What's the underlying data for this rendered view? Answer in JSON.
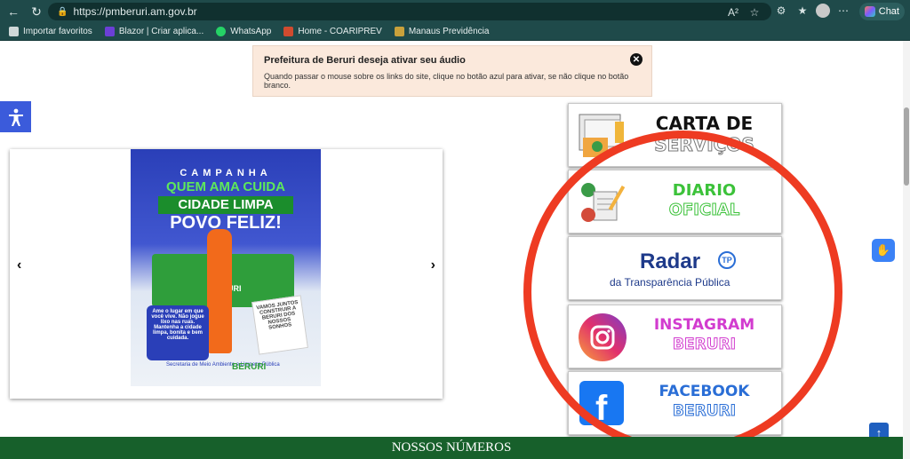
{
  "browser": {
    "url": "https://pmberuri.am.gov.br",
    "chat_label": "Chat",
    "bookmarks": [
      {
        "label": "Importar favoritos",
        "icon": "folder-icon"
      },
      {
        "label": "Blazor | Criar aplica...",
        "icon": "dotnet-icon"
      },
      {
        "label": "WhatsApp",
        "icon": "whatsapp-icon"
      },
      {
        "label": "Home - COARIPREV",
        "icon": "flag-icon"
      },
      {
        "label": "Manaus Previdência",
        "icon": "crest-icon"
      }
    ]
  },
  "audio_banner": {
    "title": "Prefeitura de Beruri deseja ativar seu áudio",
    "text": "Quando passar o mouse sobre os links do site, clique no botão azul para ativar, se não clique no botão branco."
  },
  "campaign": {
    "line1": "CAMPANHA",
    "line2": "QUEM AMA CUIDA",
    "line3": "CIDADE LIMPA",
    "line4": "POVO FELIZ!",
    "truck_label": "BERURI",
    "left_bubble": "Ame o lugar em que você vive. Não jogue lixo nas ruas. Mantenha a cidade limpa, bonita e bem cuidada.",
    "right_bubble": "VAMOS JUNTOS CONSTRUIR A BERURI DOS NOSSOS SONHOS",
    "footer": "Secretaria de Meio Ambiente e Limpeza Pública",
    "brand": "BERURI"
  },
  "cards": {
    "carta": {
      "line1": "CARTA DE",
      "line2": "SERVIÇOS"
    },
    "diario": {
      "line1": "DIARIO",
      "line2": "OFICIAL"
    },
    "radar": {
      "title": "Radar",
      "subtitle": "da Transparência Pública",
      "badge": "TP"
    },
    "instagram": {
      "line1": "INSTAGRAM",
      "line2": "BERURI"
    },
    "facebook": {
      "line1": "FACEBOOK",
      "line2": "BERURI"
    }
  },
  "section_title": "NOSSOS NÚMEROS",
  "colors": {
    "browser_bg": "#1f4a4a",
    "banner_bg": "#fbe9dc",
    "accent_blue": "#3b5bdb",
    "highlight_red": "#ee3b22",
    "footer_green": "#17602b"
  }
}
